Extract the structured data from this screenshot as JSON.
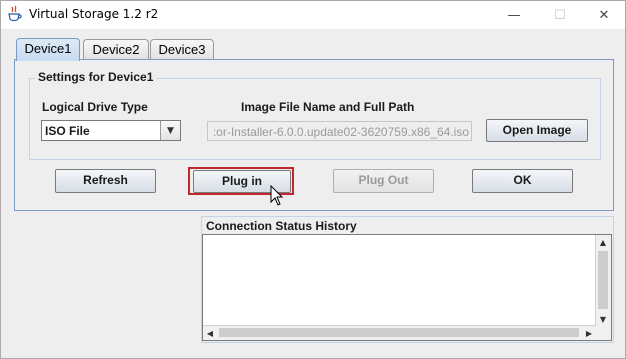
{
  "window": {
    "title": "Virtual Storage 1.2 r2",
    "minimize_glyph": "—",
    "maximize_glyph": "☐",
    "close_glyph": "✕"
  },
  "tabs": [
    {
      "label": "Device1",
      "selected": true
    },
    {
      "label": "Device2",
      "selected": false
    },
    {
      "label": "Device3",
      "selected": false
    }
  ],
  "settings": {
    "group_title": "Settings for Device1",
    "drive_type_label": "Logical Drive Type",
    "drive_type_value": "ISO File",
    "image_path_label": "Image File Name and Full Path",
    "image_path_value": ":or-Installer-6.0.0.update02-3620759.x86_64.iso",
    "open_image_label": "Open Image"
  },
  "actions": {
    "refresh_label": "Refresh",
    "plug_in_label": "Plug in",
    "plug_out_label": "Plug Out",
    "ok_label": "OK"
  },
  "history": {
    "title": "Connection Status History",
    "entries": []
  },
  "icons": {
    "app": "java-cup-icon",
    "combo_arrow": "triangle-down-icon",
    "cursor": "mouse-pointer-icon"
  },
  "colors": {
    "active_tab": "#c8dcf0",
    "highlight": "#c0272d"
  }
}
